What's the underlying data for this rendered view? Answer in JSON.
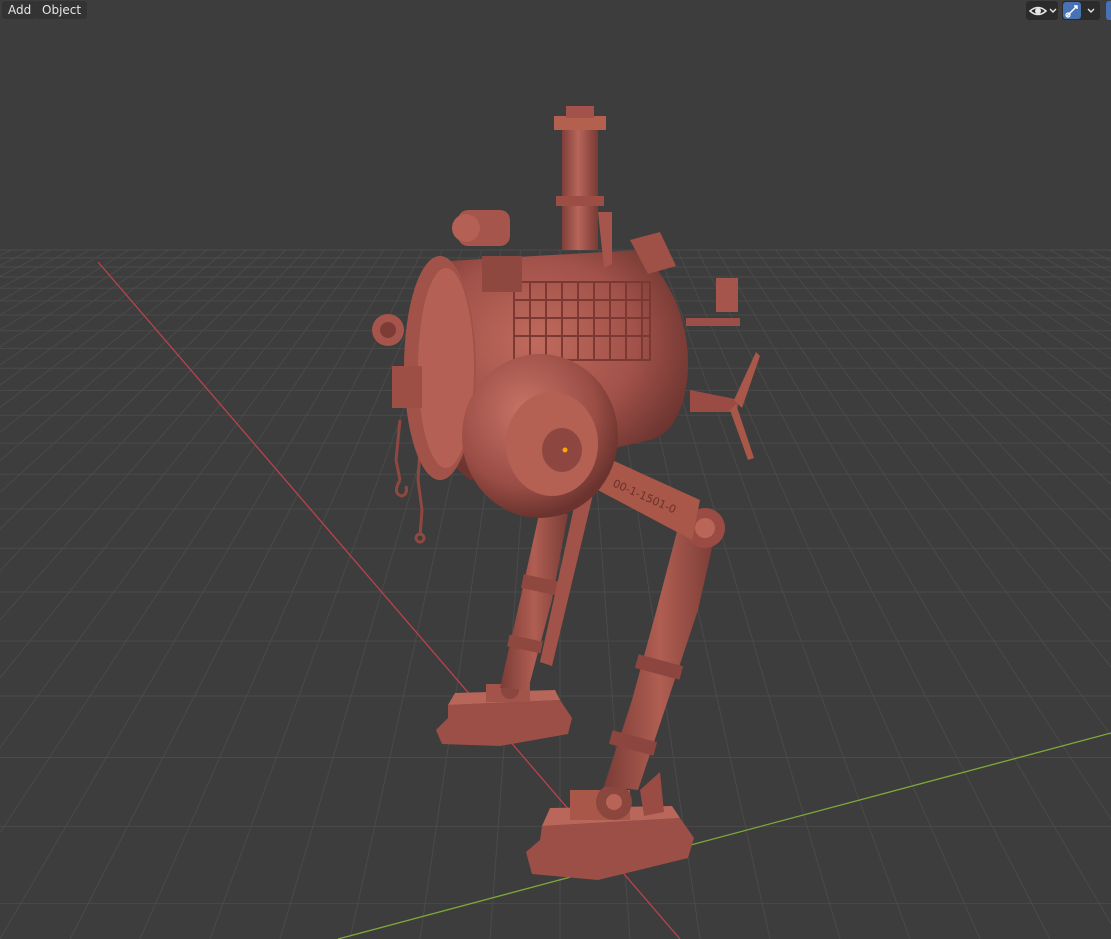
{
  "header": {
    "add_label": "Add",
    "object_label": "Object"
  },
  "header_icons": {
    "visibility": "eye-icon",
    "visibility_dropdown": "chevron-down-icon",
    "gizmo": "gizmo-icon",
    "gizmo_dropdown": "chevron-down-icon"
  },
  "viewport": {
    "background_color": "#3d3d3d",
    "grid_color": "#4a4a4a",
    "x_axis_color": "#b8434e",
    "y_axis_color": "#7ea83a",
    "model_color": "#a8564b",
    "model_part_number": "00-1-1501-0"
  }
}
